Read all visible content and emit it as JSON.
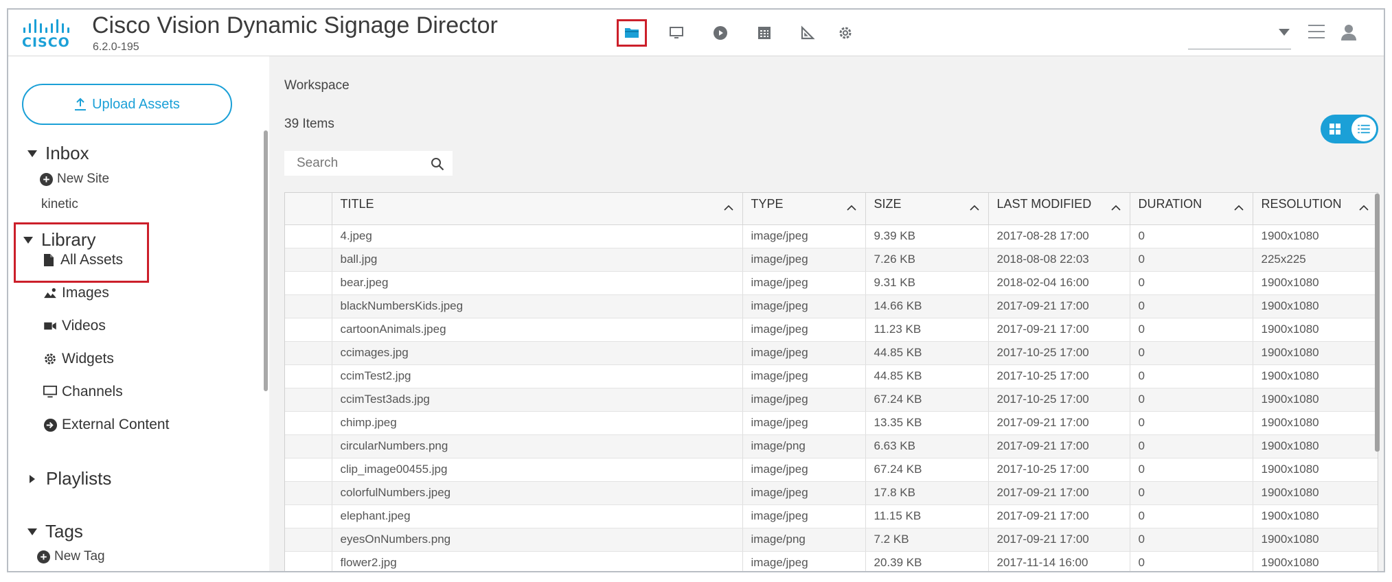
{
  "app": {
    "title": "Cisco Vision Dynamic Signage Director",
    "version": "6.2.0-195",
    "logo_text": "CISCO"
  },
  "nav": {
    "icons": [
      "folder-icon",
      "monitor-icon",
      "play-icon",
      "calendar-icon",
      "triangle-ruler-icon",
      "gear-icon"
    ],
    "active": "folder-icon"
  },
  "sidebar": {
    "upload_label": "Upload Assets",
    "inbox": {
      "label": "Inbox",
      "new_site": "New Site",
      "items": [
        "kinetic"
      ]
    },
    "library": {
      "label": "Library",
      "items": [
        "All Assets",
        "Images",
        "Videos",
        "Widgets",
        "Channels",
        "External Content"
      ]
    },
    "playlists": {
      "label": "Playlists"
    },
    "tags": {
      "label": "Tags",
      "new_tag": "New Tag"
    }
  },
  "main": {
    "breadcrumb": "Workspace",
    "item_count": "39 Items",
    "search_placeholder": "Search",
    "view_mode": "list"
  },
  "table": {
    "columns": [
      "TITLE",
      "TYPE",
      "SIZE",
      "LAST MODIFIED",
      "DURATION",
      "RESOLUTION"
    ],
    "rows": [
      [
        "4.jpeg",
        "image/jpeg",
        "9.39 KB",
        "2017-08-28 17:00",
        "0",
        "1900x1080"
      ],
      [
        "ball.jpg",
        "image/jpeg",
        "7.26 KB",
        "2018-08-08 22:03",
        "0",
        "225x225"
      ],
      [
        "bear.jpeg",
        "image/jpeg",
        "9.31 KB",
        "2018-02-04 16:00",
        "0",
        "1900x1080"
      ],
      [
        "blackNumbersKids.jpeg",
        "image/jpeg",
        "14.66 KB",
        "2017-09-21 17:00",
        "0",
        "1900x1080"
      ],
      [
        "cartoonAnimals.jpeg",
        "image/jpeg",
        "11.23 KB",
        "2017-09-21 17:00",
        "0",
        "1900x1080"
      ],
      [
        "ccimages.jpg",
        "image/jpeg",
        "44.85 KB",
        "2017-10-25 17:00",
        "0",
        "1900x1080"
      ],
      [
        "ccimTest2.jpg",
        "image/jpeg",
        "44.85 KB",
        "2017-10-25 17:00",
        "0",
        "1900x1080"
      ],
      [
        "ccimTest3ads.jpg",
        "image/jpeg",
        "67.24 KB",
        "2017-10-25 17:00",
        "0",
        "1900x1080"
      ],
      [
        "chimp.jpeg",
        "image/jpeg",
        "13.35 KB",
        "2017-09-21 17:00",
        "0",
        "1900x1080"
      ],
      [
        "circularNumbers.png",
        "image/png",
        "6.63 KB",
        "2017-09-21 17:00",
        "0",
        "1900x1080"
      ],
      [
        "clip_image00455.jpg",
        "image/jpeg",
        "67.24 KB",
        "2017-10-25 17:00",
        "0",
        "1900x1080"
      ],
      [
        "colorfulNumbers.jpeg",
        "image/jpeg",
        "17.8 KB",
        "2017-09-21 17:00",
        "0",
        "1900x1080"
      ],
      [
        "elephant.jpeg",
        "image/jpeg",
        "11.15 KB",
        "2017-09-21 17:00",
        "0",
        "1900x1080"
      ],
      [
        "eyesOnNumbers.png",
        "image/png",
        "7.2 KB",
        "2017-09-21 17:00",
        "0",
        "1900x1080"
      ],
      [
        "flower2.jpg",
        "image/jpeg",
        "20.39 KB",
        "2017-11-14 16:00",
        "0",
        "1900x1080"
      ]
    ]
  },
  "colors": {
    "accent": "#1ba0d7",
    "highlight": "#cc1f2a",
    "main_bg": "#f2f2f2"
  }
}
